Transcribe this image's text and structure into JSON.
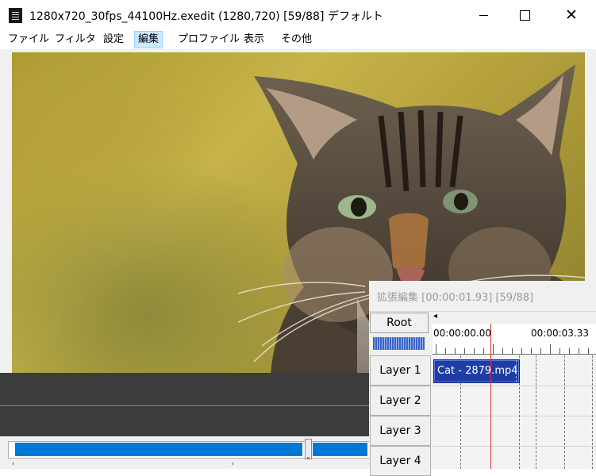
{
  "window": {
    "title": "1280x720_30fps_44100Hz.exedit (1280,720)  [59/88]  デフォルト",
    "icon": "film-icon",
    "controls": [
      "minimize-icon",
      "maximize-icon",
      "close-icon"
    ],
    "close_glyph": "✕"
  },
  "menu": {
    "items": [
      "ファイル",
      "フィルタ",
      "設定",
      "編集",
      "プロファイル",
      "表示",
      "その他"
    ],
    "active": "編集"
  },
  "preview": {
    "content": "cat photo"
  },
  "seekbar": {
    "position": 0.83
  },
  "extended_edit": {
    "title": "拡張編集 [00:00:01.93] [59/88]",
    "root_label": "Root",
    "scroll_left_glyph": "◂",
    "time_labels": [
      "00:00:00.00",
      "00:00:03.33"
    ],
    "layers": [
      "Layer 1",
      "Layer 2",
      "Layer 3",
      "Layer 4"
    ],
    "clip": {
      "label": "Cat - 2879.mp4",
      "color": "#1f3da6"
    },
    "cursor_color": "#e0302a"
  }
}
